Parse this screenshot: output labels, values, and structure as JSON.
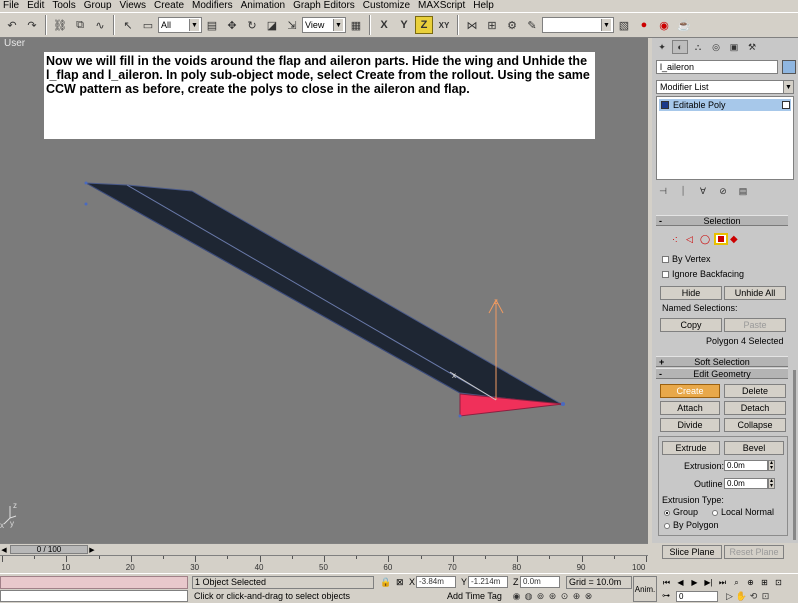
{
  "menu": [
    "File",
    "Edit",
    "Tools",
    "Group",
    "Views",
    "Create",
    "Modifiers",
    "Animation",
    "Graph Editors",
    "Customize",
    "MAXScript",
    "Help"
  ],
  "toolbar": {
    "selection_filter": "All",
    "ref_coord": "View",
    "named_sel": ""
  },
  "viewport": {
    "label": "User",
    "note": "Now we will fill in the voids around the flap and aileron parts.  Hide the wing and Unhide the l_flap and l_aileron.  In poly sub-object mode, select Create from the rollout.  Using the same CCW pattern as before, create the polys to close in the aileron and flap."
  },
  "panel": {
    "object_name": "l_aileron",
    "modifier_list": "Modifier List",
    "stack_item": "Editable Poly",
    "selection": {
      "title": "Selection",
      "by_vertex": "By Vertex",
      "ignore_backfacing": "Ignore Backfacing",
      "hide": "Hide",
      "unhide_all": "Unhide All",
      "named_selections": "Named Selections:",
      "copy": "Copy",
      "paste": "Paste",
      "status": "Polygon 4 Selected"
    },
    "soft_selection": "Soft Selection",
    "edit_geometry": {
      "title": "Edit Geometry",
      "create": "Create",
      "delete": "Delete",
      "attach": "Attach",
      "detach": "Detach",
      "divide": "Divide",
      "collapse": "Collapse",
      "extrude": "Extrude",
      "bevel": "Bevel",
      "extrusion_label": "Extrusion:",
      "extrusion_val": "0.0m",
      "outline_label": "Outline",
      "outline_val": "0.0m",
      "extrusion_type": "Extrusion Type:",
      "group": "Group",
      "local_normal": "Local Normal",
      "by_polygon": "By Polygon",
      "slice_plane": "Slice Plane",
      "reset_plane": "Reset Plane"
    }
  },
  "timeline": {
    "frame": "0 / 100",
    "ticks": [
      "10",
      "20",
      "30",
      "40",
      "50",
      "60",
      "70",
      "80",
      "90",
      "100"
    ]
  },
  "status": {
    "selected": "1 Object Selected",
    "prompt": "Click or click-and-drag to select objects",
    "x_label": "X",
    "x_val": "-3.84m",
    "y_label": "Y",
    "y_val": "-1.214m",
    "z_label": "Z",
    "z_val": "0.0m",
    "grid": "Grid = 10.0m",
    "add_time_tag": "Add Time Tag",
    "anim": "Anim.",
    "frame_field": "0"
  },
  "colors": {
    "viewport_bg": "#7b7b7b",
    "wing_fill": "#1e2633",
    "selected_poly": "#f0305a",
    "gizmo": "#f09a60"
  }
}
